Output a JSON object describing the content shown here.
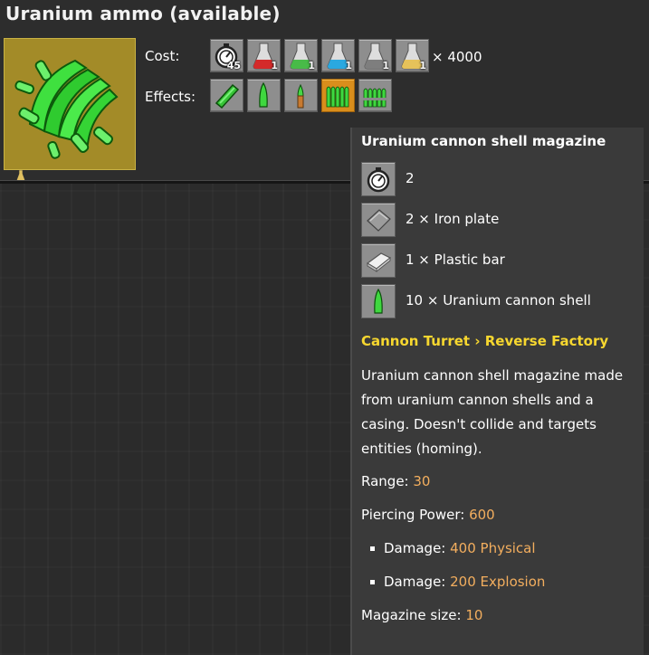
{
  "header": {
    "title": "Uranium ammo (available)"
  },
  "technology": {
    "icon": "uranium-ammo-icon",
    "background_color": "#a38b28",
    "flask_icons": [
      "automation-science-icon",
      "logistic-science-icon",
      "military-science-icon",
      "chemical-science-icon",
      "utility-science-icon"
    ]
  },
  "cost": {
    "label": "Cost:",
    "items": [
      {
        "icon": "time-icon",
        "count": "45"
      },
      {
        "icon": "red-science-flask-icon",
        "count": "1"
      },
      {
        "icon": "green-science-flask-icon",
        "count": "1"
      },
      {
        "icon": "blue-science-flask-icon",
        "count": "1"
      },
      {
        "icon": "grey-science-flask-icon",
        "count": "1"
      },
      {
        "icon": "yellow-science-flask-icon",
        "count": "1"
      }
    ],
    "multiplier": "× 4000"
  },
  "effects": {
    "label": "Effects:",
    "items": [
      {
        "icon": "uranium-magazine-icon"
      },
      {
        "icon": "uranium-cannon-shell-icon"
      },
      {
        "icon": "uranium-rounds-icon"
      },
      {
        "icon": "uranium-cannon-shell-magazine-icon",
        "selected": true
      },
      {
        "icon": "uranium-cannon-shell-box-icon"
      }
    ]
  },
  "tooltip": {
    "title": "Uranium cannon shell magazine",
    "recipe": [
      {
        "icon": "time-icon",
        "text": "2"
      },
      {
        "icon": "iron-plate-icon",
        "text": "2 × Iron plate"
      },
      {
        "icon": "plastic-bar-icon",
        "text": "1 × Plastic bar"
      },
      {
        "icon": "uranium-cannon-shell-icon",
        "text": "10 × Uranium cannon shell"
      }
    ],
    "category": "Cannon Turret › Reverse Factory",
    "description": "Uranium cannon shell magazine made from uranium cannon shells and a casing. Doesn't collide and targets entities (homing).",
    "range_label": "Range: ",
    "range_value": "30",
    "piercing_label": "Piercing Power: ",
    "piercing_value": "600",
    "damage1_label": "Damage: ",
    "damage1_value": "400 Physical",
    "damage2_label": "Damage: ",
    "damage2_value": "200 Explosion",
    "magazine_label": "Magazine size: ",
    "magazine_value": "10",
    "accent_color": "#f3ae5e",
    "category_color": "#f7d72f"
  }
}
